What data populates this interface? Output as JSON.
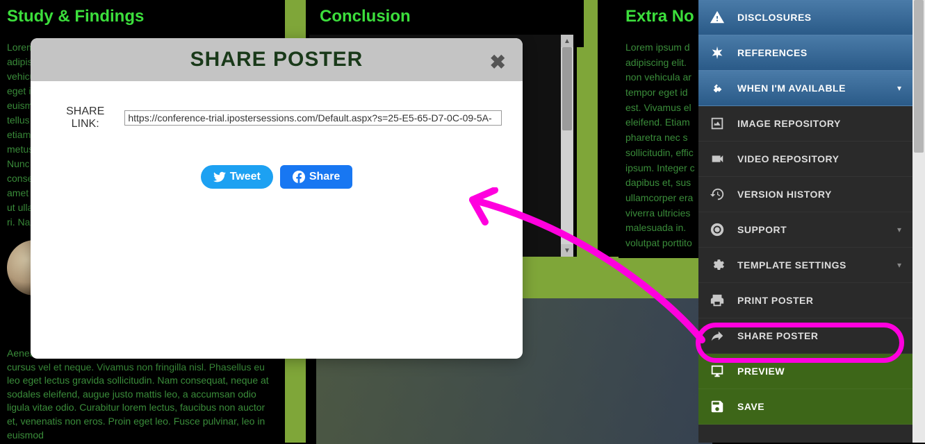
{
  "poster": {
    "col1_heading": "Study & Findings",
    "col2_heading": "Conclusion",
    "col3_heading": "Extra No",
    "lorem1_part1": "Lorem\nadipis\nvehicu\neget i\neuismo\ntellus k\netiam l\nmetus\nNunc a\nconse\namet d\nut ulla\nri. Nar",
    "lorem1_part2": "Aenea\npellentesque. Donec non ligula non lacus maximus cursus vel et neque. Vivamus non fringilla nisl. Phasellus eu leo eget lectus gravida sollicitudin. Nam consequat, neque at sodales eleifend, augue justo mattis leo, a accumsan odio ligula vitae odio. Curabitur lorem lectus, faucibus non auctor et, venenatis non eros. Proin eget leo. Fusce pulvinar, leo in euismod",
    "lorem3": "Lorem ipsum d\nadipiscing elit.\nnon vehicula ar\ntempor eget id\nest. Vivamus el\neleifend. Etiam\npharetra nec s\nsollicitudin, effic\nipsum. Integer c\ndapibus et, sus\nullamcorper era\nviverra ultricies\nmalesuada in.\nvolutpat porttito"
  },
  "modal": {
    "title": "SHARE POSTER",
    "share_label": "SHARE LINK:",
    "share_value": "https://conference-trial.ipostersessions.com/Default.aspx?s=25-E5-65-D7-0C-09-5A-",
    "tweet_label": "Tweet",
    "share_btn_label": "Share"
  },
  "sidebar": {
    "items": [
      {
        "label": "DISCLOSURES",
        "icon": "warning-icon",
        "chevron": false,
        "bg": "blue"
      },
      {
        "label": "REFERENCES",
        "icon": "asterisk-icon",
        "chevron": false,
        "bg": "blue"
      },
      {
        "label": "WHEN I'M AVAILABLE",
        "icon": "handshake-icon",
        "chevron": true,
        "bg": "blue"
      },
      {
        "label": "IMAGE REPOSITORY",
        "icon": "image-icon",
        "chevron": false,
        "bg": "dark"
      },
      {
        "label": "VIDEO REPOSITORY",
        "icon": "video-icon",
        "chevron": false,
        "bg": "dark"
      },
      {
        "label": "VERSION HISTORY",
        "icon": "history-icon",
        "chevron": false,
        "bg": "dark"
      },
      {
        "label": "SUPPORT",
        "icon": "life-ring-icon",
        "chevron": true,
        "bg": "dark"
      },
      {
        "label": "TEMPLATE SETTINGS",
        "icon": "settings-icon",
        "chevron": true,
        "bg": "dark"
      },
      {
        "label": "PRINT POSTER",
        "icon": "print-icon",
        "chevron": false,
        "bg": "dark"
      },
      {
        "label": "SHARE POSTER",
        "icon": "share-icon",
        "chevron": false,
        "bg": "dark"
      },
      {
        "label": "PREVIEW",
        "icon": "monitor-icon",
        "chevron": false,
        "bg": "green"
      },
      {
        "label": "SAVE",
        "icon": "save-icon",
        "chevron": false,
        "bg": "green"
      }
    ]
  }
}
